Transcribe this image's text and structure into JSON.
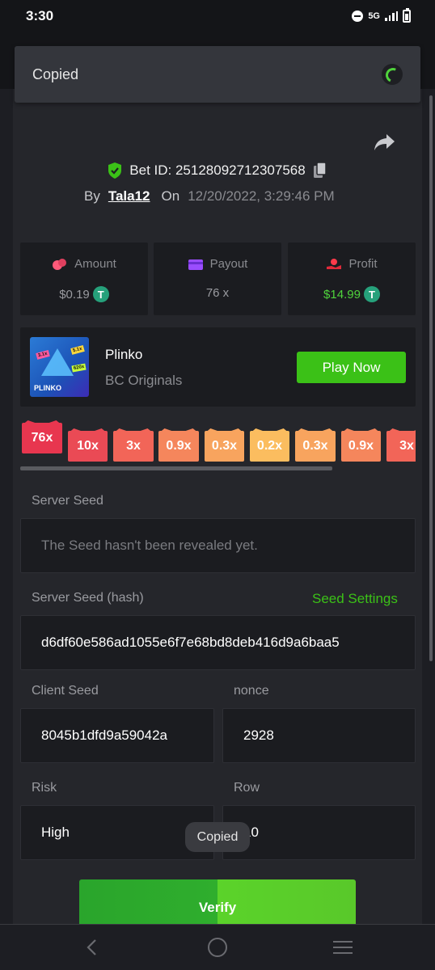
{
  "status_bar": {
    "time": "3:30",
    "network": "5G"
  },
  "toast_top": {
    "text": "Copied"
  },
  "bet": {
    "id_label": "Bet ID: 25128092712307568",
    "by_label": "By",
    "user": "Tala12",
    "on_label": "On",
    "date": "12/20/2022, 3:29:46 PM"
  },
  "stats": [
    {
      "label": "Amount",
      "value": "$0.19",
      "icon": "coins-icon",
      "has_token": true
    },
    {
      "label": "Payout",
      "value": "76 x",
      "icon": "wallet-icon",
      "has_token": false
    },
    {
      "label": "Profit",
      "value": "$14.99",
      "icon": "profit-hand-icon",
      "has_token": true
    }
  ],
  "token_symbol": "T",
  "game": {
    "title": "Plinko",
    "subtitle": "BC Originals",
    "play_label": "Play Now",
    "thumb_label": "PLINKO",
    "thumb_tags": [
      "3.1x",
      "5.1x",
      "620x"
    ]
  },
  "multipliers": [
    {
      "label": "76x",
      "color": "#e8364f",
      "hit": true
    },
    {
      "label": "10x",
      "color": "#ea4a55",
      "hit": false
    },
    {
      "label": "3x",
      "color": "#f26558",
      "hit": false
    },
    {
      "label": "0.9x",
      "color": "#f5865c",
      "hit": false
    },
    {
      "label": "0.3x",
      "color": "#f8a45e",
      "hit": false
    },
    {
      "label": "0.2x",
      "color": "#fbbd5f",
      "hit": false
    },
    {
      "label": "0.3x",
      "color": "#f8a45e",
      "hit": false
    },
    {
      "label": "0.9x",
      "color": "#f5865c",
      "hit": false
    },
    {
      "label": "3x",
      "color": "#f26558",
      "hit": false
    }
  ],
  "fields": {
    "server_seed_label": "Server Seed",
    "server_seed_placeholder": "The Seed hasn't been revealed yet.",
    "server_hash_label": "Server Seed (hash)",
    "seed_settings_label": "Seed Settings",
    "server_hash_value": "d6df60e586ad1055e6f7e68bd8deb416d9a6baa5",
    "client_seed_label": "Client Seed",
    "client_seed_value": "8045b1dfd9a59042a",
    "nonce_label": "nonce",
    "nonce_value": "2928",
    "risk_label": "Risk",
    "risk_value": "High",
    "row_label": "Row",
    "row_value": "10"
  },
  "verify_label": "Verify",
  "toast_bottom": {
    "text": "Copied"
  },
  "colors": {
    "accent_green": "#3bc117",
    "panel": "#25262b",
    "card": "#1b1c20"
  }
}
